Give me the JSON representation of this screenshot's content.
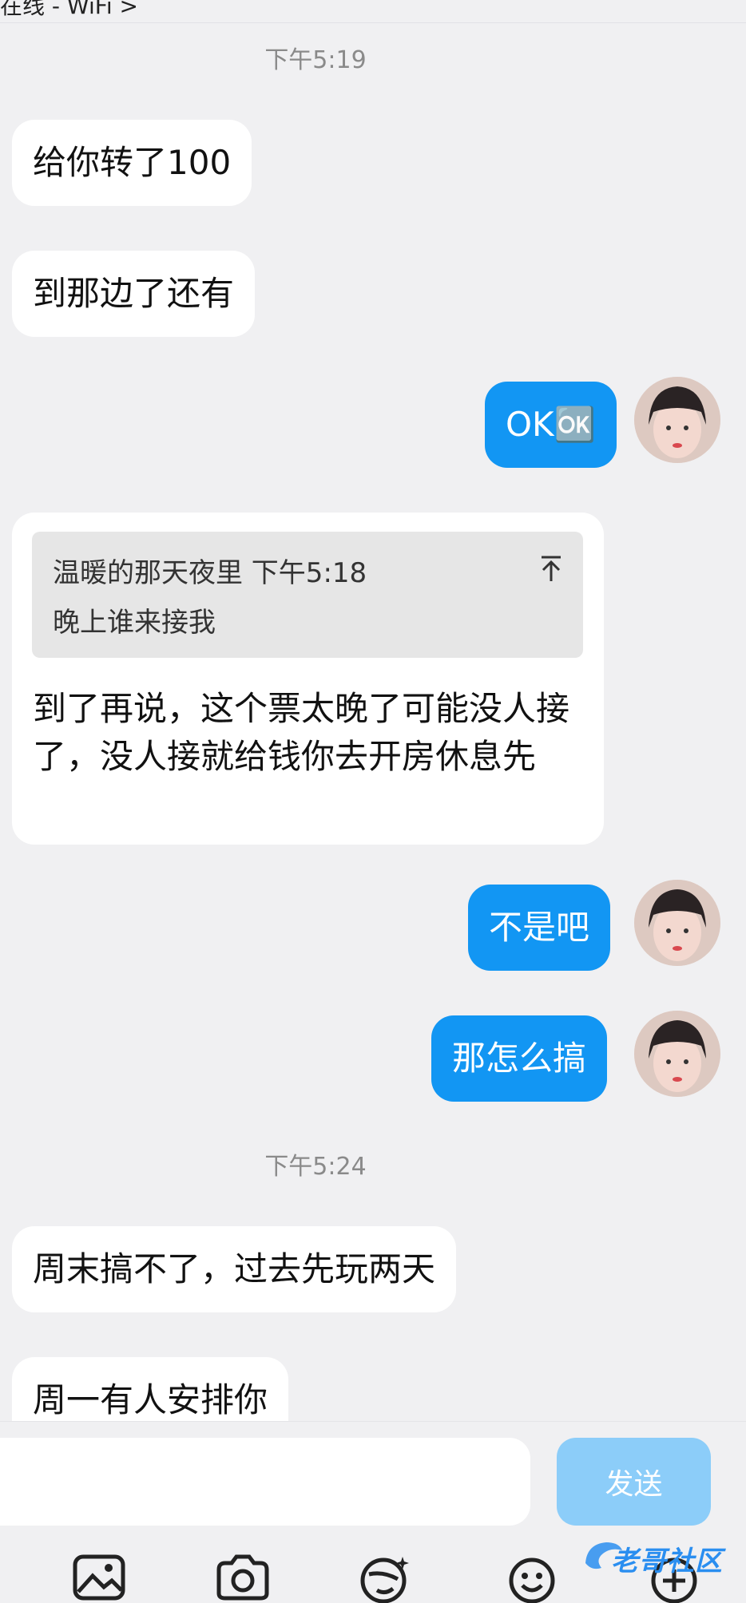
{
  "status_bar": {
    "text": "在线 - WiFi >"
  },
  "messages": {
    "time1": "下午5:19",
    "m1": "给你转了100",
    "m2": "到那边了还有",
    "m3": "OK🆗",
    "quote_header": "温暖的那天夜里 下午5:18",
    "quote_body": "晚上谁来接我",
    "m4": "到了再说，这个票太晚了可能没人接了，没人接就给钱你去开房休息先",
    "m5": "不是吧",
    "m6": "那怎么搞",
    "time2": "下午5:24",
    "m7": "周末搞不了，过去先玩两天",
    "m8": "周一有人安排你"
  },
  "input": {
    "placeholder": "",
    "send_label": "发送"
  },
  "toolbar": {
    "icons": [
      "image-icon",
      "camera-icon",
      "sticker-icon",
      "emoji-icon",
      "plus-icon"
    ]
  },
  "watermark": {
    "text": "老哥社区"
  },
  "colors": {
    "accent": "#1296f3",
    "send_disabled": "#8ccdf9",
    "background": "#f0f0f2"
  }
}
